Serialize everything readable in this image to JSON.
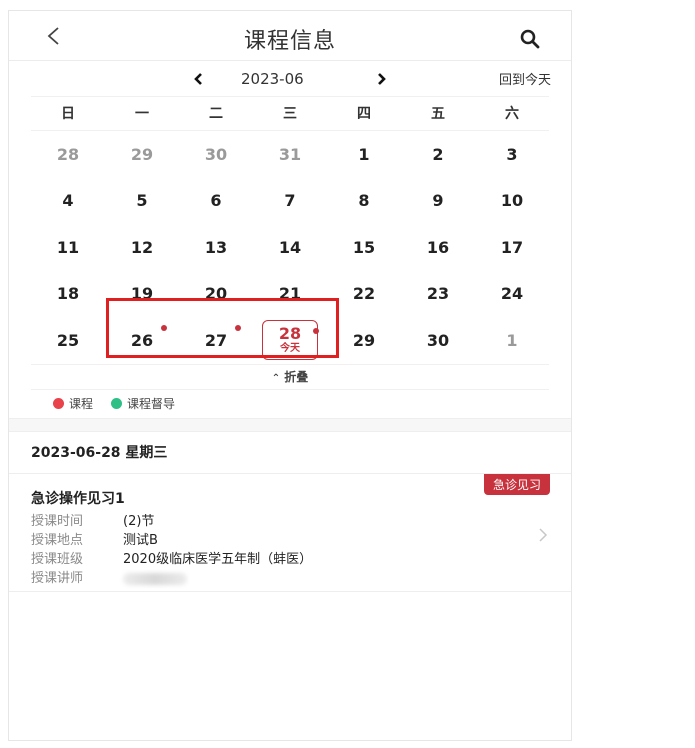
{
  "header": {
    "title": "课程信息"
  },
  "month_nav": {
    "month": "2023-06",
    "back_today": "回到今天"
  },
  "weekdays": [
    "日",
    "一",
    "二",
    "三",
    "四",
    "五",
    "六"
  ],
  "weeks": [
    [
      {
        "d": "28",
        "muted": true
      },
      {
        "d": "29",
        "muted": true
      },
      {
        "d": "30",
        "muted": true
      },
      {
        "d": "31",
        "muted": true
      },
      {
        "d": "1"
      },
      {
        "d": "2"
      },
      {
        "d": "3"
      }
    ],
    [
      {
        "d": "4"
      },
      {
        "d": "5"
      },
      {
        "d": "6"
      },
      {
        "d": "7"
      },
      {
        "d": "8"
      },
      {
        "d": "9"
      },
      {
        "d": "10"
      }
    ],
    [
      {
        "d": "11"
      },
      {
        "d": "12"
      },
      {
        "d": "13"
      },
      {
        "d": "14"
      },
      {
        "d": "15"
      },
      {
        "d": "16"
      },
      {
        "d": "17"
      }
    ],
    [
      {
        "d": "18"
      },
      {
        "d": "19"
      },
      {
        "d": "20"
      },
      {
        "d": "21"
      },
      {
        "d": "22"
      },
      {
        "d": "23"
      },
      {
        "d": "24"
      }
    ],
    [
      {
        "d": "25"
      },
      {
        "d": "26",
        "dot": true
      },
      {
        "d": "27",
        "dot": true
      },
      {
        "d": "28",
        "dot": true,
        "today": true
      },
      {
        "d": "29"
      },
      {
        "d": "30"
      },
      {
        "d": "1",
        "muted": true
      }
    ]
  ],
  "today_label": "今天",
  "collapse_label": "折叠",
  "legend": [
    {
      "label": "课程",
      "color": "#e8424b"
    },
    {
      "label": "课程督导",
      "color": "#2dbf86"
    }
  ],
  "selected_date": "2023-06-28 星期三",
  "course": {
    "tag": "急诊见习",
    "name": "急诊操作见习1",
    "time_label": "授课时间",
    "time_value": "(2)节",
    "place_label": "授课地点",
    "place_value": "测试B",
    "class_label": "授课班级",
    "class_value": "2020级临床医学五年制（蚌医）",
    "teacher_label": "授课讲师"
  },
  "colors": {
    "accent": "#c8323d",
    "highlight_border": "#e02020"
  }
}
